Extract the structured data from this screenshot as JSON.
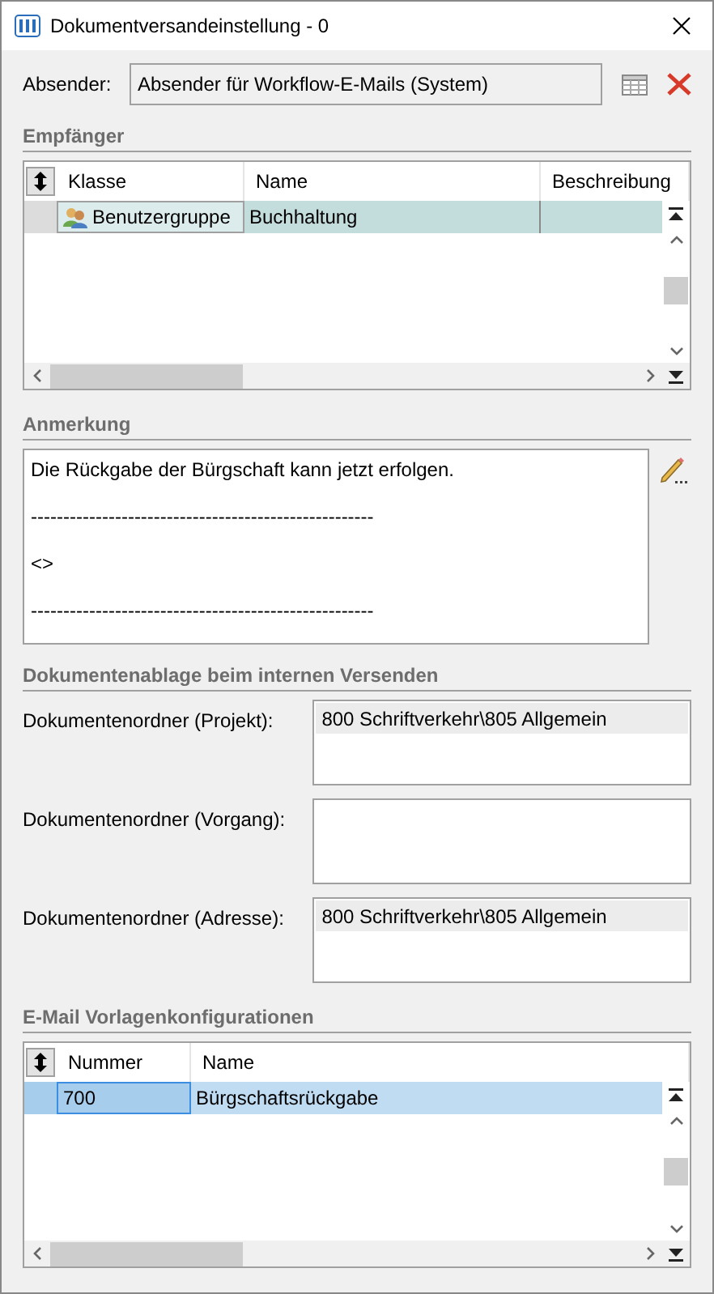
{
  "window": {
    "title": "Dokumentversandeinstellung - 0"
  },
  "sender": {
    "label": "Absender:",
    "value": "Absender für Workflow-E-Mails (System)"
  },
  "recipients": {
    "heading": "Empfänger",
    "focused": false,
    "columns": [
      "Klasse",
      "Name",
      "Beschreibung"
    ],
    "rows": [
      {
        "selected": true,
        "cells": [
          "Benutzergruppe",
          "Buchhaltung"
        ]
      }
    ]
  },
  "note": {
    "heading": "Anmerkung",
    "lines": [
      "Die Rückgabe der Bürgschaft kann jetzt erfolgen.",
      "-----------------------------------------------------",
      "<>",
      "-----------------------------------------------------"
    ]
  },
  "storage": {
    "heading": "Dokumentenablage beim internen Versenden",
    "fields": [
      {
        "label": "Dokumentenordner (Projekt):",
        "items": [
          "800 Schriftverkehr\\805 Allgemein"
        ]
      },
      {
        "label": "Dokumentenordner (Vorgang):"
      },
      {
        "label": "Dokumentenordner (Adresse):",
        "items": [
          "800 Schriftverkehr\\805 Allgemein"
        ]
      }
    ]
  },
  "templates": {
    "heading": "E-Mail Vorlagenkonfigurationen",
    "focused": true,
    "columns": [
      "Nummer",
      "Name"
    ],
    "rows": [
      {
        "selected": true,
        "cells": [
          "700",
          "Bürgschaftsrückgabe"
        ]
      }
    ]
  }
}
